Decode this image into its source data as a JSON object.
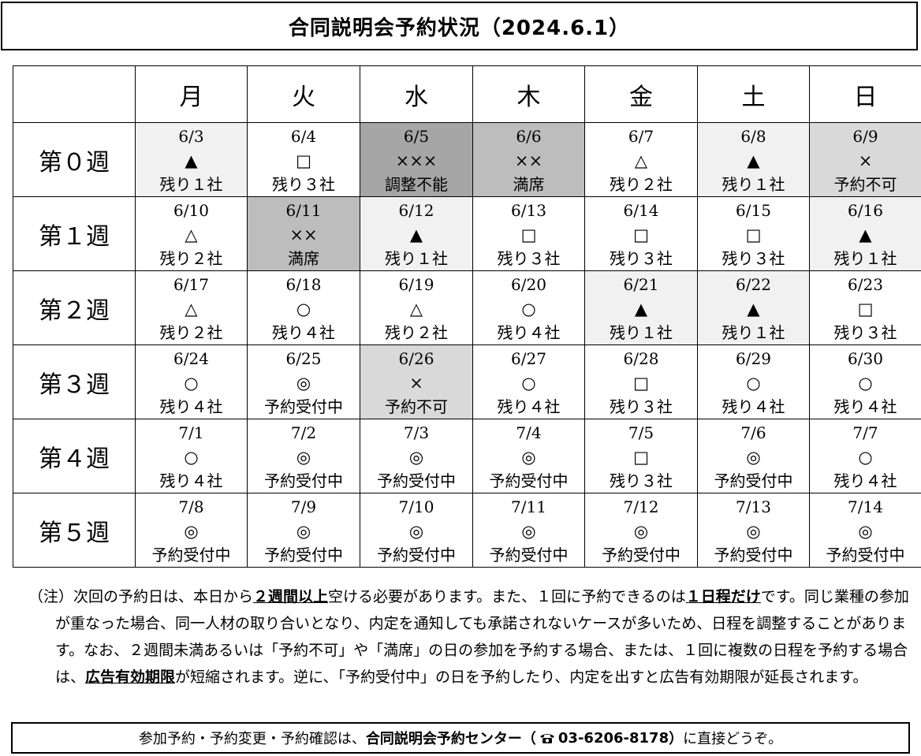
{
  "title": "合同説明会予約状況（2024.6.1）",
  "days": [
    "月",
    "火",
    "水",
    "木",
    "金",
    "土",
    "日"
  ],
  "weeks": [
    {
      "label": "第０週",
      "cells": [
        {
          "date": "6/3",
          "mark": "▲",
          "status": "残り１社",
          "shade": "#f1f1f1"
        },
        {
          "date": "6/4",
          "mark": "□",
          "status": "残り３社",
          "shade": "#ffffff"
        },
        {
          "date": "6/5",
          "mark": "×××",
          "status": "調整不能",
          "shade": "#a6a6a6"
        },
        {
          "date": "6/6",
          "mark": "××",
          "status": "満席",
          "shade": "#bdbdbd"
        },
        {
          "date": "6/7",
          "mark": "△",
          "status": "残り２社",
          "shade": "#ffffff"
        },
        {
          "date": "6/8",
          "mark": "▲",
          "status": "残り１社",
          "shade": "#f1f1f1"
        },
        {
          "date": "6/9",
          "mark": "×",
          "status": "予約不可",
          "shade": "#d9d9d9"
        }
      ]
    },
    {
      "label": "第１週",
      "cells": [
        {
          "date": "6/10",
          "mark": "△",
          "status": "残り２社",
          "shade": "#ffffff"
        },
        {
          "date": "6/11",
          "mark": "××",
          "status": "満席",
          "shade": "#bdbdbd"
        },
        {
          "date": "6/12",
          "mark": "▲",
          "status": "残り１社",
          "shade": "#f1f1f1"
        },
        {
          "date": "6/13",
          "mark": "□",
          "status": "残り３社",
          "shade": "#ffffff"
        },
        {
          "date": "6/14",
          "mark": "□",
          "status": "残り３社",
          "shade": "#ffffff"
        },
        {
          "date": "6/15",
          "mark": "□",
          "status": "残り３社",
          "shade": "#ffffff"
        },
        {
          "date": "6/16",
          "mark": "▲",
          "status": "残り１社",
          "shade": "#f1f1f1"
        }
      ]
    },
    {
      "label": "第２週",
      "cells": [
        {
          "date": "6/17",
          "mark": "△",
          "status": "残り２社",
          "shade": "#ffffff"
        },
        {
          "date": "6/18",
          "mark": "○",
          "status": "残り４社",
          "shade": "#ffffff"
        },
        {
          "date": "6/19",
          "mark": "△",
          "status": "残り２社",
          "shade": "#ffffff"
        },
        {
          "date": "6/20",
          "mark": "○",
          "status": "残り４社",
          "shade": "#ffffff"
        },
        {
          "date": "6/21",
          "mark": "▲",
          "status": "残り１社",
          "shade": "#f1f1f1"
        },
        {
          "date": "6/22",
          "mark": "▲",
          "status": "残り１社",
          "shade": "#f1f1f1"
        },
        {
          "date": "6/23",
          "mark": "□",
          "status": "残り３社",
          "shade": "#ffffff"
        }
      ]
    },
    {
      "label": "第３週",
      "cells": [
        {
          "date": "6/24",
          "mark": "○",
          "status": "残り４社",
          "shade": "#ffffff"
        },
        {
          "date": "6/25",
          "mark": "◎",
          "status": "予約受付中",
          "shade": "#ffffff"
        },
        {
          "date": "6/26",
          "mark": "×",
          "status": "予約不可",
          "shade": "#d9d9d9"
        },
        {
          "date": "6/27",
          "mark": "○",
          "status": "残り４社",
          "shade": "#ffffff"
        },
        {
          "date": "6/28",
          "mark": "□",
          "status": "残り３社",
          "shade": "#ffffff"
        },
        {
          "date": "6/29",
          "mark": "○",
          "status": "残り４社",
          "shade": "#ffffff"
        },
        {
          "date": "6/30",
          "mark": "○",
          "status": "残り４社",
          "shade": "#ffffff"
        }
      ]
    },
    {
      "label": "第４週",
      "cells": [
        {
          "date": "7/1",
          "mark": "○",
          "status": "残り４社",
          "shade": "#ffffff"
        },
        {
          "date": "7/2",
          "mark": "◎",
          "status": "予約受付中",
          "shade": "#ffffff"
        },
        {
          "date": "7/3",
          "mark": "◎",
          "status": "予約受付中",
          "shade": "#ffffff"
        },
        {
          "date": "7/4",
          "mark": "◎",
          "status": "予約受付中",
          "shade": "#ffffff"
        },
        {
          "date": "7/5",
          "mark": "□",
          "status": "残り３社",
          "shade": "#ffffff"
        },
        {
          "date": "7/6",
          "mark": "◎",
          "status": "予約受付中",
          "shade": "#ffffff"
        },
        {
          "date": "7/7",
          "mark": "○",
          "status": "残り４社",
          "shade": "#ffffff"
        }
      ]
    },
    {
      "label": "第５週",
      "cells": [
        {
          "date": "7/8",
          "mark": "◎",
          "status": "予約受付中",
          "shade": "#ffffff"
        },
        {
          "date": "7/9",
          "mark": "◎",
          "status": "予約受付中",
          "shade": "#ffffff"
        },
        {
          "date": "7/10",
          "mark": "◎",
          "status": "予約受付中",
          "shade": "#ffffff"
        },
        {
          "date": "7/11",
          "mark": "◎",
          "status": "予約受付中",
          "shade": "#ffffff"
        },
        {
          "date": "7/12",
          "mark": "◎",
          "status": "予約受付中",
          "shade": "#ffffff"
        },
        {
          "date": "7/13",
          "mark": "◎",
          "status": "予約受付中",
          "shade": "#ffffff"
        },
        {
          "date": "7/14",
          "mark": "◎",
          "status": "予約受付中",
          "shade": "#ffffff"
        }
      ]
    }
  ],
  "note": {
    "prefix": "（注）",
    "t1": "次回の予約日は、本日から",
    "em1": "２週間以上",
    "t2": "空ける必要があります。また、１回に予約できるのは",
    "em2": "１日程だけ",
    "t3": "です。同じ業種の参加が重なった場合、同一人材の取り合いとなり、内定を通知しても承諾されないケースが多いため、日程を調整することがあります。なお、２週間未満あるいは「予約不可」や「満席」の日の参加を予約する場合、または、１回に複数の日程を予約する場合は、",
    "em3": "広告有効期限",
    "t4": "が短縮されます。逆に、「予約受付中」の日を予約したり、内定を出すと広告有効期限が延長されます。"
  },
  "footer": {
    "t1": "参加予約・予約変更・予約確認は、",
    "center_name": "合同説明会予約センター",
    "phone_open": "（",
    "phone_icon": "telephone-icon",
    "phone": "03-6206-8178",
    "phone_close": "）",
    "t2": "に直接どうぞ。"
  }
}
